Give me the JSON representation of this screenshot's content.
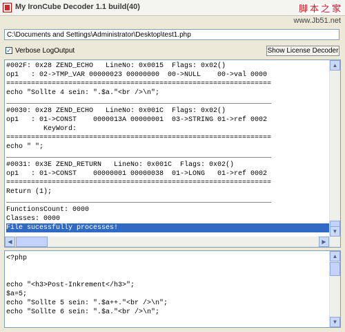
{
  "window": {
    "title": "My IronCube Decoder 1.1 build(40)"
  },
  "watermark": {
    "chars": [
      "脚",
      "本",
      "之",
      "家"
    ],
    "url": "www.Jb51.net"
  },
  "path_field": {
    "value": "C:\\Documents and Settings\\Administrator\\Desktop\\test1.php"
  },
  "verbose": {
    "label": "Verbose LogOutput",
    "checked_glyph": "✓"
  },
  "license_button": {
    "label": "Show License Decoder"
  },
  "output_lines": [
    "#002F: 0x28 ZEND_ECHO   LineNo: 0x0015  Flags: 0x02()",
    "op1   : 02->TMP_VAR 00000023 00000000  00->NULL    00->val 0000",
    "================================================================",
    "echo \"Sollte 4 sein: \".$a.\"<br />\\n\";",
    "________________________________________________________________",
    "#0030: 0x28 ZEND_ECHO   LineNo: 0x001C  Flags: 0x02()",
    "op1   : 01->CONST    0000013A 00000001  03->STRING 01->ref 0002",
    "         KeyWord:",
    "================================================================",
    "echo \" \";",
    "________________________________________________________________",
    "#0031: 0x3E ZEND_RETURN   LineNo: 0x001C  Flags: 0x02()",
    "op1   : 01->CONST    00000001 00000038  01->LONG   01->ref 0002",
    "================================================================",
    "Return (1);",
    "________________________________________________________________",
    "FunctionsCount: 0000",
    "Classes: 0000",
    "File sucessfully processes!"
  ],
  "source_lines": [
    "<?php",
    "",
    "",
    "echo \"<h3>Post-Inkrement</h3>\";",
    "$a=5;",
    "echo \"Sollte 5 sein: \".$a++.\"<br />\\n\";",
    "echo \"Sollte 6 sein: \".$a.\"<br />\\n\";"
  ],
  "scroll_glyphs": {
    "up": "▲",
    "down": "▼",
    "left": "◀",
    "right": "▶"
  }
}
